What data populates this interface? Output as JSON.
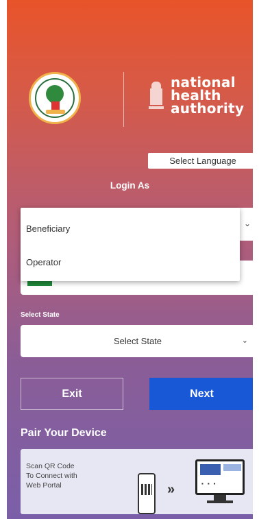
{
  "language_button": "Select Language",
  "login_as_label": "Login As",
  "login_dropdown": {
    "options": [
      "Beneficiary",
      "Operator"
    ]
  },
  "state": {
    "label": "Select State",
    "placeholder": "Select State"
  },
  "buttons": {
    "exit": "Exit",
    "next": "Next"
  },
  "pair": {
    "title": "Pair Your Device",
    "lines": [
      "Scan QR Code",
      "To Connect with",
      "Web Portal"
    ]
  },
  "branding": {
    "nha_line1": "national",
    "nha_line2": "health",
    "nha_line3": "authority"
  },
  "colors": {
    "gradient_top": "#e8542a",
    "gradient_bottom": "#7a5fa8",
    "next_button": "#1857d6",
    "accent_green": "#1f8a3a"
  }
}
